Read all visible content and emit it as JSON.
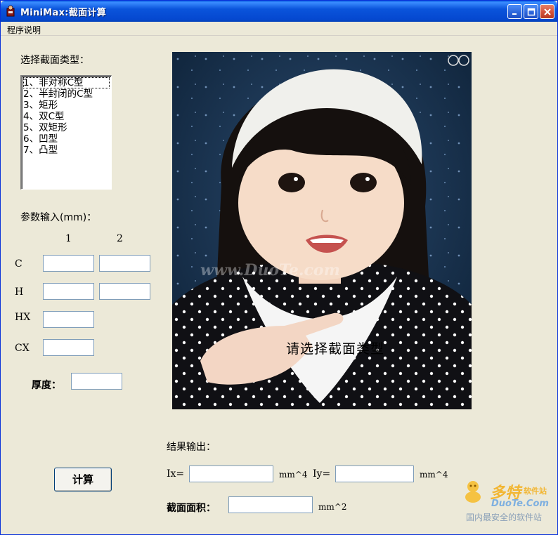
{
  "window": {
    "title": "MiniMax:截面计算",
    "controls": [
      "minimize",
      "maximize",
      "close"
    ]
  },
  "menu": {
    "items": [
      "程序说明"
    ]
  },
  "section_type": {
    "label": "选择截面类型：",
    "options": [
      "1、非对称C型",
      "2、半封闭的C型",
      "3、矩形",
      "4、双C型",
      "5、双矩形",
      "6、凹型",
      "7、凸型"
    ],
    "focused_index": 0
  },
  "params": {
    "label": "参数输入(mm)：",
    "col1": "1",
    "col2": "2",
    "rows": {
      "c": "C",
      "h": "H",
      "hx": "HX",
      "cx": "CX"
    },
    "thickness_label": "厚度：",
    "values": {
      "c1": "",
      "c2": "",
      "h1": "",
      "h2": "",
      "hx1": "",
      "cx1": "",
      "thickness": ""
    }
  },
  "preview": {
    "caption": "请选择截面类型",
    "watermark": "www.DuoTe.com"
  },
  "results": {
    "label": "结果输出：",
    "ix_label": "Ix=",
    "ix_unit": "mm^4",
    "iy_label": "Iy=",
    "iy_unit": "mm^4",
    "area_label": "截面面积：",
    "area_unit": "mm^2",
    "values": {
      "ix": "",
      "iy": "",
      "area": ""
    }
  },
  "actions": {
    "calculate": "计算"
  },
  "site_watermark": {
    "brand": "多特",
    "brand_suffix": "软件站",
    "domain": "DuoTe.Com",
    "slogan": "国内最安全的软件站"
  },
  "colors": {
    "titlebar": "#0A54DB",
    "window_bg": "#ECE9D8",
    "textbox_border": "#7F9DB9"
  }
}
